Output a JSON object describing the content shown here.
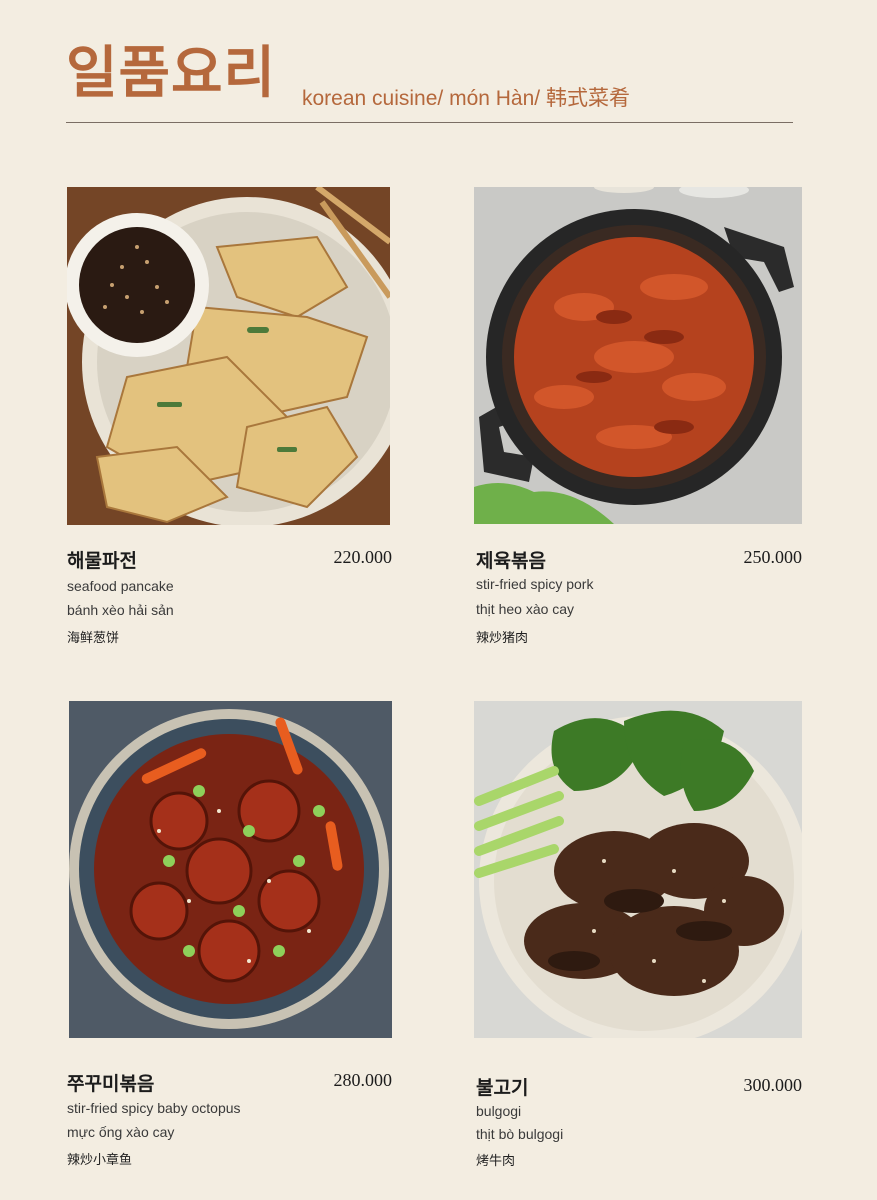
{
  "header": {
    "title_ko": "일품요리",
    "title_sub": "korean cuisine/ món Hàn/ 韩式菜肴"
  },
  "items": [
    {
      "name": "해물파전",
      "price": "220.000",
      "en": "seafood pancake",
      "vi": "bánh xèo hải sản",
      "zh": "海鲜葱饼",
      "image": "seafood-pancake-photo"
    },
    {
      "name": "제육볶음",
      "price": "250.000",
      "en": "stir-fried spicy pork",
      "vi": "thịt heo xào cay",
      "zh": "辣炒猪肉",
      "image": "spicy-pork-photo"
    },
    {
      "name": "쭈꾸미볶음",
      "price": "280.000",
      "en": "stir-fried spicy baby octopus",
      "vi": "mực ống xào cay",
      "zh": "辣炒小章鱼",
      "image": "baby-octopus-photo"
    },
    {
      "name": "불고기",
      "price": "300.000",
      "en": "bulgogi",
      "vi": "thịt bò bulgogi",
      "zh": "烤牛肉",
      "image": "bulgogi-photo"
    }
  ],
  "colors": {
    "accent": "#b5683c",
    "background": "#f3ede1"
  }
}
